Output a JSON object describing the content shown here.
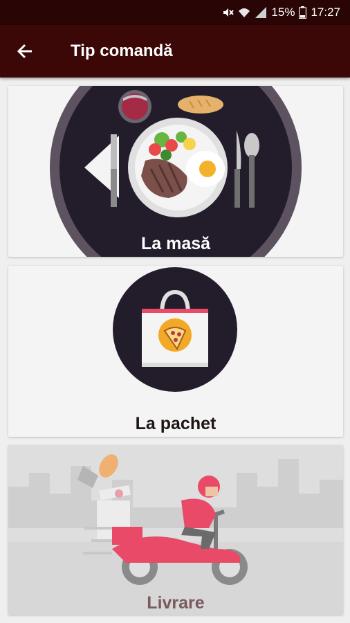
{
  "status_bar": {
    "battery_percent": "15%",
    "time": "17:27",
    "icons": [
      "mute-icon",
      "wifi-icon",
      "signal-icon",
      "battery-icon"
    ]
  },
  "app_bar": {
    "title": "Tip comandă",
    "back_icon": "arrow-left-icon"
  },
  "options": [
    {
      "label": "La masă",
      "icon": "dinner-plate-illustration"
    },
    {
      "label": "La pachet",
      "icon": "pizza-bag-illustration"
    },
    {
      "label": "Livrare",
      "icon": "delivery-scooter-illustration"
    }
  ],
  "colors": {
    "status_bar": "#2a0505",
    "app_bar": "#3b0707",
    "plate_dark": "#231d2b",
    "accent_red": "#e84a68",
    "label_dark": "#1e1414",
    "label_muted": "#7a5a5f"
  }
}
